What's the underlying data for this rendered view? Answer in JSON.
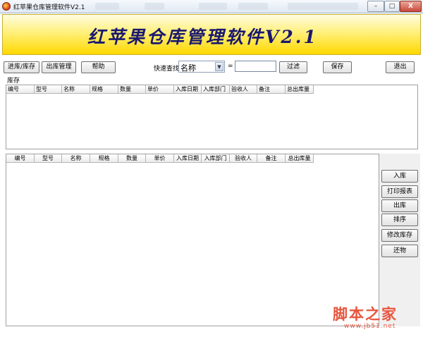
{
  "window": {
    "title": "红苹果仓库管理软件V2.1",
    "minimize_label": "–",
    "maximize_label": "□",
    "close_label": "X"
  },
  "banner": {
    "title": "红苹果仓库管理软件V2.1"
  },
  "toolbar": {
    "in_stock_label": "进库/库存",
    "out_manage_label": "出库管理",
    "help_label": "帮助",
    "quick_search_label": "快速查找",
    "search_field": "名称",
    "equals_label": "=",
    "search_value": "",
    "filter_label": "过滤",
    "save_label": "保存",
    "exit_label": "退出"
  },
  "inventory": {
    "section_label": "库存",
    "columns": [
      "编号",
      "型号",
      "名称",
      "规格",
      "数量",
      "单价",
      "入库日期",
      "入库部门",
      "验收人",
      "备注",
      "总出库量"
    ]
  },
  "lower_grid": {
    "columns": [
      "编号",
      "型号",
      "名称",
      "规格",
      "数量",
      "单价",
      "入库日期",
      "入库部门",
      "验收人",
      "备注",
      "总出库量"
    ]
  },
  "side_actions": {
    "stock_in_label": "入库",
    "print_report_label": "打印报表",
    "stock_out_label": "出库",
    "sort_label": "排序",
    "edit_stock_label": "修改库存",
    "return_label": "还物"
  },
  "watermark": {
    "main": "脚本之家",
    "url": "www.jb51.net"
  },
  "colors": {
    "banner_text": "#1a1870",
    "banner_bg": "#ffd800",
    "watermark": "#e8553e"
  }
}
